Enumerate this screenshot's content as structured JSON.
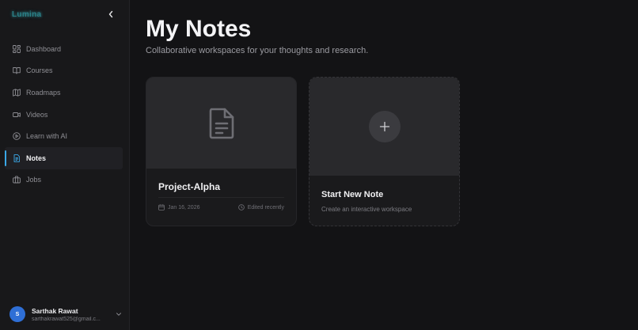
{
  "app": {
    "brand": "Lumina"
  },
  "sidebar": {
    "items": [
      {
        "label": "Dashboard",
        "icon": "dashboard-icon",
        "active": false
      },
      {
        "label": "Courses",
        "icon": "book-icon",
        "active": false
      },
      {
        "label": "Roadmaps",
        "icon": "map-icon",
        "active": false
      },
      {
        "label": "Videos",
        "icon": "video-icon",
        "active": false
      },
      {
        "label": "Learn with AI",
        "icon": "play-circle-icon",
        "active": false
      },
      {
        "label": "Notes",
        "icon": "note-icon",
        "active": true
      },
      {
        "label": "Jobs",
        "icon": "briefcase-icon",
        "active": false
      }
    ],
    "user": {
      "initial": "S",
      "name": "Sarthak Rawat",
      "email": "sarthakrawat525@gmail.c..."
    }
  },
  "page": {
    "title": "My Notes",
    "subtitle": "Collaborative workspaces for your thoughts and research."
  },
  "notes": [
    {
      "title": "Project-Alpha",
      "date": "Jan 16, 2026",
      "edited": "Edited recently"
    }
  ],
  "new_note": {
    "title": "Start New Note",
    "subtitle": "Create an interactive workspace"
  },
  "colors": {
    "accent": "#3aa8e8",
    "avatar": "#2f6fd6",
    "background": "#131315",
    "sidebar": "#18181a"
  }
}
